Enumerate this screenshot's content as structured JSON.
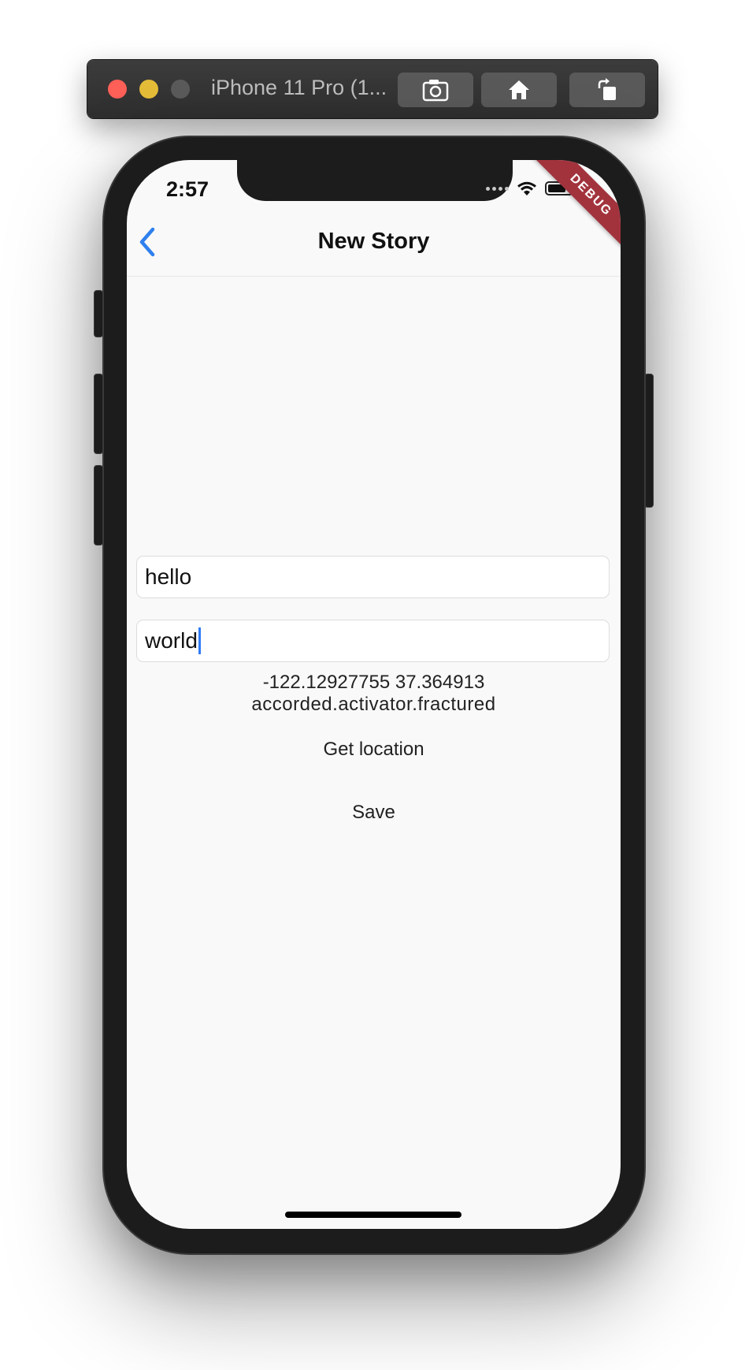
{
  "simulator": {
    "title": "iPhone 11 Pro (1...",
    "toolbar_icons": [
      "screenshot-icon",
      "home-icon",
      "rotate-icon"
    ]
  },
  "status_bar": {
    "time": "2:57"
  },
  "debug_banner": "DEBUG",
  "navbar": {
    "title": "New Story",
    "back_icon": "chevron-left-icon",
    "accent_color": "#2f80ed"
  },
  "form": {
    "title_value": "hello",
    "body_value": "world",
    "coordinates": "-122.12927755 37.364913",
    "words": "accorded.activator.fractured",
    "get_location_label": "Get location",
    "save_label": "Save"
  }
}
